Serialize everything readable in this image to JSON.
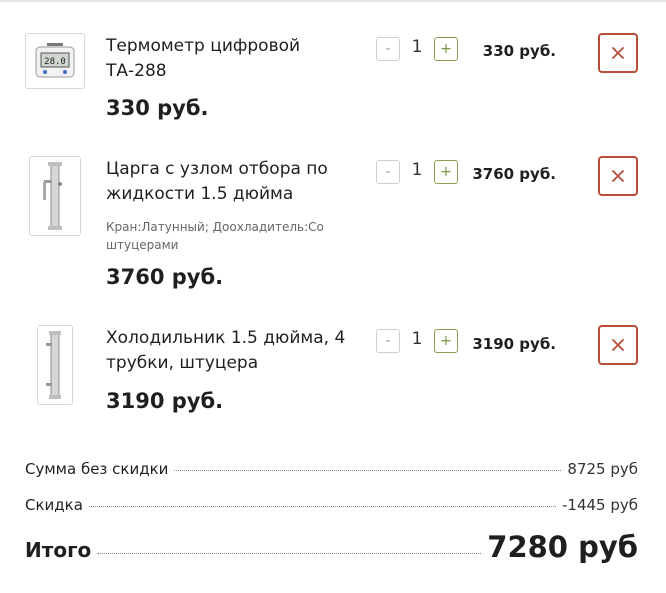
{
  "currency_short": "руб.",
  "colors": {
    "delete_border": "#b84d3a",
    "plus_border": "#8aa050"
  },
  "cart": {
    "items": [
      {
        "name": "Термометр цифровой ТА-288",
        "options": "",
        "price": "330 руб.",
        "quantity": "1",
        "line_price": "330 руб.",
        "minus_label": "-",
        "plus_label": "+",
        "image_icon": "digital-thermometer-icon"
      },
      {
        "name": "Царга с узлом отбора по жидкости 1.5 дюйма",
        "options": "Кран:Латунный; Доохладитель:Со штуцерами",
        "price": "3760 руб.",
        "quantity": "1",
        "line_price": "3760 руб.",
        "minus_label": "-",
        "plus_label": "+",
        "image_icon": "column-section-icon"
      },
      {
        "name": "Холодильник 1.5 дюйма, 4 трубки, штуцера",
        "options": "",
        "price": "3190 руб.",
        "quantity": "1",
        "line_price": "3190 руб.",
        "minus_label": "-",
        "plus_label": "+",
        "image_icon": "condenser-tube-icon"
      }
    ]
  },
  "summary": {
    "subtotal_label": "Сумма без скидки",
    "subtotal_value": "8725 руб",
    "discount_label": "Скидка",
    "discount_value": "-1445 руб",
    "total_label": "Итого",
    "total_value": "7280 руб"
  }
}
